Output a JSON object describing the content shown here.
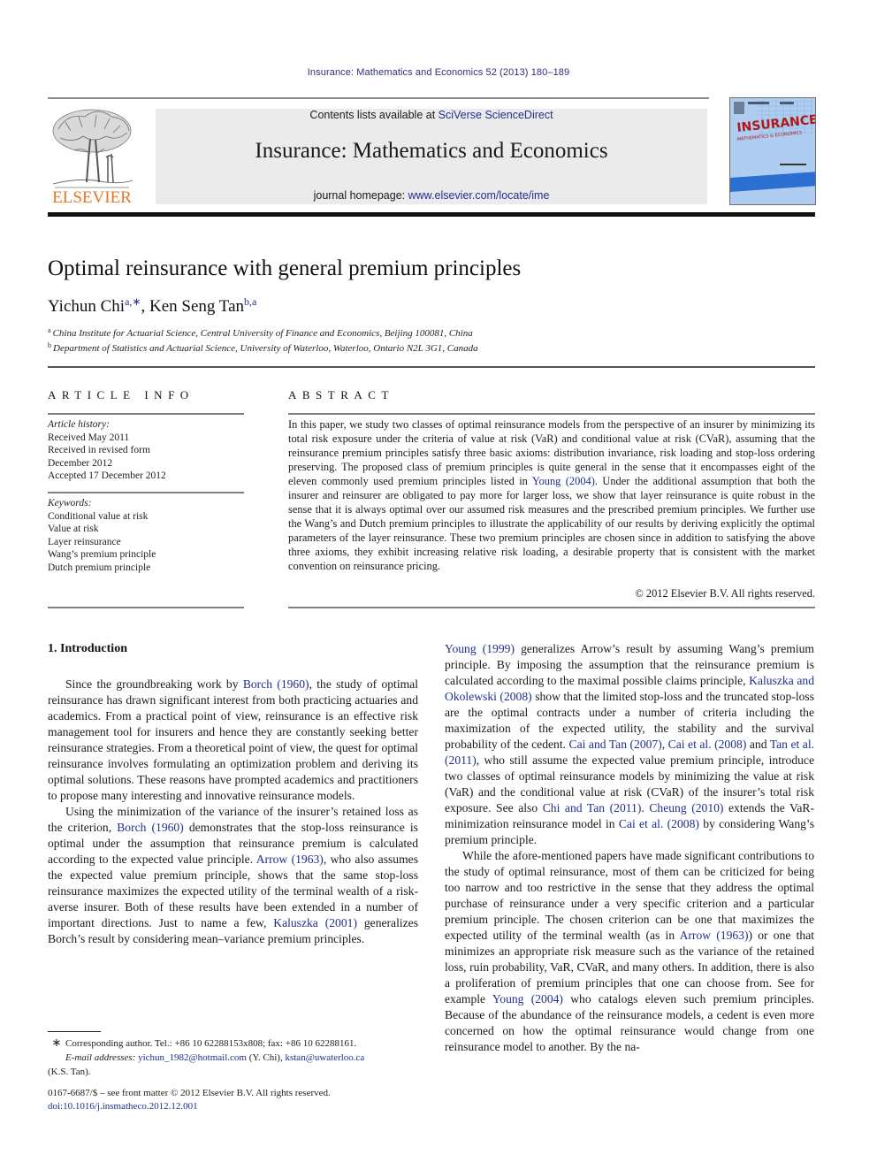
{
  "header": {
    "journal_ref": "Insurance: Mathematics and Economics 52 (2013) 180–189",
    "contents_prefix": "Contents lists available at ",
    "contents_link": "SciVerse ScienceDirect",
    "journal_title": "Insurance: Mathematics and Economics",
    "homepage_prefix": "journal homepage: ",
    "homepage_link": "www.elsevier.com/locate/ime",
    "publisher_logo_text": "ELSEVIER",
    "cover_title": "INSURANCE",
    "cover_subtitle": "MATHEMATICS & ECONOMICS",
    "colors": {
      "elsevier_orange": "#e87722",
      "link_blue": "#1f2f8f",
      "cover_blue": "#aecdf0",
      "cover_red": "#b01818",
      "banner_grey": "#ebebeb"
    }
  },
  "article": {
    "title": "Optimal reinsurance with general premium principles",
    "authors": [
      {
        "name": "Yichun Chi",
        "marks": "a,∗"
      },
      {
        "name": "Ken Seng Tan",
        "marks": "b,a"
      }
    ],
    "author_separator": ", ",
    "affiliations": [
      {
        "mark": "a",
        "text": "China Institute for Actuarial Science, Central University of Finance and Economics, Beijing 100081, China"
      },
      {
        "mark": "b",
        "text": "Department of Statistics and Actuarial Science, University of Waterloo, Waterloo, Ontario N2L 3G1, Canada"
      }
    ]
  },
  "article_info": {
    "heading": "ARTICLE INFO",
    "history_label": "Article history:",
    "history": [
      "Received May 2011",
      "Received in revised form",
      "December 2012",
      "Accepted 17 December 2012"
    ],
    "keywords_label": "Keywords:",
    "keywords": [
      "Conditional value at risk",
      "Value at risk",
      "Layer reinsurance",
      "Wang’s premium principle",
      "Dutch premium principle"
    ]
  },
  "abstract": {
    "heading": "ABSTRACT",
    "text_1": "In this paper, we study two classes of optimal reinsurance models from the perspective of an insurer by minimizing its total risk exposure under the criteria of value at risk (VaR) and conditional value at risk (CVaR), assuming that the reinsurance premium principles satisfy three basic axioms: distribution invariance, risk loading and stop-loss ordering preserving. The proposed class of premium principles is quite general in the sense that it encompasses eight of the eleven commonly used premium principles listed in ",
    "link_1": "Young (2004)",
    "text_2": ". Under the additional assumption that both the insurer and reinsurer are obligated to pay more for larger loss, we show that layer reinsurance is quite robust in the sense that it is always optimal over our assumed risk measures and the prescribed premium principles. We further use the Wang’s and Dutch premium principles to illustrate the applicability of our results by deriving explicitly the optimal parameters of the layer reinsurance. These two premium principles are chosen since in addition to satisfying the above three axioms, they exhibit increasing relative risk loading, a desirable property that is consistent with the market convention on reinsurance pricing.",
    "copyright": "© 2012 Elsevier B.V. All rights reserved."
  },
  "introduction": {
    "heading": "1.  Introduction",
    "left_column": {
      "p1": [
        {
          "t": "Since the groundbreaking work by "
        },
        {
          "link": "Borch (1960)"
        },
        {
          "t": ", the study of optimal reinsurance has drawn significant interest from both practicing actuaries and academics. From a practical point of view, reinsurance is an effective risk management tool for insurers and hence they are constantly seeking better reinsurance strategies. From a theoretical point of view, the quest for optimal reinsurance involves formulating an optimization problem and deriving its optimal solutions. These reasons have prompted academics and practitioners to propose many interesting and innovative reinsurance models."
        }
      ],
      "p2": [
        {
          "t": "Using the minimization of the variance of the insurer’s retained loss as the criterion, "
        },
        {
          "link": "Borch (1960)"
        },
        {
          "t": " demonstrates that the stop-loss reinsurance is optimal under the assumption that reinsurance premium is calculated according to the expected value principle. "
        },
        {
          "link": "Arrow (1963)"
        },
        {
          "t": ", who also assumes the expected value premium principle, shows that the same stop-loss reinsurance maximizes the expected utility of the terminal wealth of a risk-averse insurer. Both of these results have been extended in a number of important directions. Just to name a few, "
        },
        {
          "link": "Kaluszka (2001)"
        },
        {
          "t": " generalizes Borch’s result by considering mean–variance premium principles."
        }
      ]
    },
    "right_column": {
      "p1": [
        {
          "link": "Young (1999)"
        },
        {
          "t": " generalizes Arrow’s result by assuming Wang’s premium principle. By imposing the assumption that the reinsurance premium is calculated according to the maximal possible claims principle, "
        },
        {
          "link": "Kaluszka and Okolewski (2008)"
        },
        {
          "t": " show that the limited stop-loss and the truncated stop-loss are the optimal contracts under a number of criteria including the maximization of the expected utility, the stability and the survival probability of the cedent. "
        },
        {
          "link": "Cai and Tan (2007)"
        },
        {
          "t": ", "
        },
        {
          "link": "Cai et al. (2008)"
        },
        {
          "t": " and "
        },
        {
          "link": "Tan et al. (2011)"
        },
        {
          "t": ", who still assume the expected value premium principle, introduce two classes of optimal reinsurance models by minimizing the value at risk (VaR) and the conditional value at risk (CVaR) of the insurer’s total risk exposure. See also "
        },
        {
          "link": "Chi and Tan (2011)"
        },
        {
          "t": ". "
        },
        {
          "link": "Cheung (2010)"
        },
        {
          "t": " extends the VaR-minimization reinsurance model in "
        },
        {
          "link": "Cai et al. (2008)"
        },
        {
          "t": " by considering Wang’s premium principle."
        }
      ],
      "p2": [
        {
          "t": "While the afore-mentioned papers have made significant contributions to the study of optimal reinsurance, most of them can be criticized for being too narrow and too restrictive in the sense that they address the optimal purchase of reinsurance under a very specific criterion and a particular premium principle. The chosen criterion can be one that maximizes the expected utility of the terminal wealth (as in "
        },
        {
          "link": "Arrow (1963)"
        },
        {
          "t": ") or one that minimizes an appropriate risk measure such as the variance of the retained loss, ruin probability, VaR, CVaR, and many others. In addition, there is also a proliferation of premium principles that one can choose from. See for example "
        },
        {
          "link": "Young (2004)"
        },
        {
          "t": " who catalogs eleven such premium principles. Because of the abundance of the reinsurance models, a cedent is even more concerned on how the optimal reinsurance would change from one reinsurance model to another. By the na-"
        }
      ]
    }
  },
  "footnotes": {
    "star": "∗",
    "corresponding": "Corresponding author. Tel.: +86 10 62288153x808; fax: +86 10 62288161.",
    "email_label": "E-mail addresses: ",
    "email_1": "yichun_1982@hotmail.com",
    "email_1_owner": " (Y. Chi), ",
    "email_2": "kstan@uwaterloo.ca",
    "email_2_owner": "(K.S. Tan).",
    "front_matter": "0167-6687/$ – see front matter © 2012 Elsevier B.V. All rights reserved.",
    "doi": "doi:10.1016/j.insmatheco.2012.12.001"
  }
}
